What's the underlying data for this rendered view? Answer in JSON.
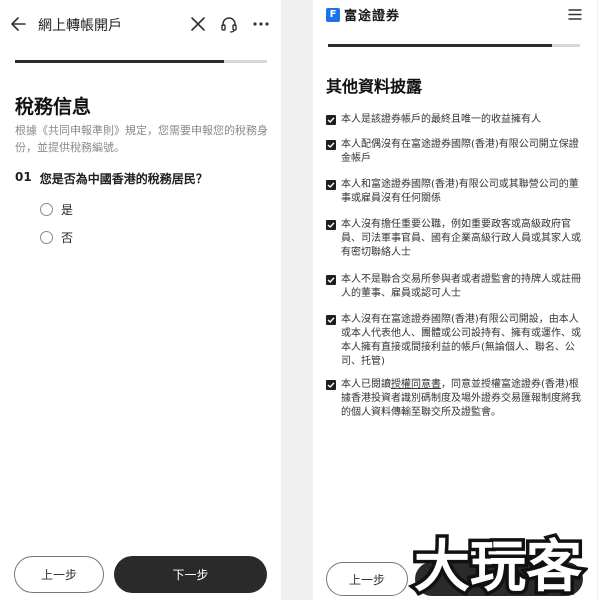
{
  "left": {
    "header": {
      "title": "網上轉帳開戶"
    },
    "progress": 0.83,
    "section_title": "稅務信息",
    "description": "根據《共同申報準則》規定，您需要申報您的稅務身份，並提供稅務編號。",
    "question": {
      "number": "01",
      "text": "您是否為中國香港的稅務居民？"
    },
    "options": [
      "是",
      "否"
    ],
    "buttons": {
      "prev": "上一步",
      "next": "下一步"
    }
  },
  "right": {
    "brand": {
      "logo_glyph": "F",
      "name": "富途證券",
      "color": "#1a73e8"
    },
    "progress": 0.89,
    "section_title": "其他資料披露",
    "items": [
      {
        "text": "本人是該證券帳戶的最終且唯一的收益擁有人"
      },
      {
        "text": "本人配偶沒有在富途證券國際(香港)有限公司開立保證金帳戶"
      },
      {
        "text": "本人和富途證券國際(香港)有限公司或其聯營公司的董事或雇員沒有任何關係"
      },
      {
        "text": "本人沒有擔任重要公職，例如重要政客或高級政府官員、司法軍事官員、國有企業高級行政人員或其家人或有密切聯絡人士"
      },
      {
        "text": "本人不是聯合交易所參與者或者證監會的持牌人或註冊人的董事、雇員或認可人士"
      },
      {
        "text": "本人沒有在富途證券國際(香港)有限公司開設，由本人或本人代表他人、團體或公司設持有、擁有或運作、或本人擁有直接或間接利益的帳戶(無論個人、聯名、公司、托管)"
      },
      {
        "prefix": "本人已閱讀",
        "link": "授權同意書",
        "suffix": "，同意並授權富途證券(香港)根據香港投資者識別碼制度及場外證券交易匯報制度將我的個人資料傳輸至聯交所及證監會。"
      }
    ],
    "buttons": {
      "prev": "上一步",
      "next": "下一步"
    }
  },
  "watermark": "大玩客"
}
